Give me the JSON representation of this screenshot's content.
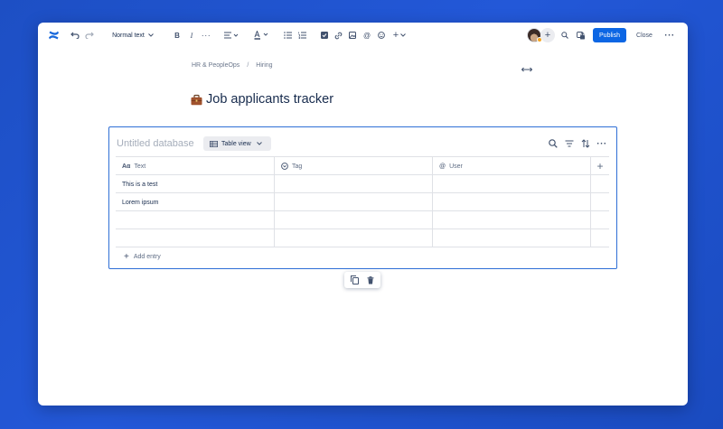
{
  "toolbar": {
    "brand_icon": "confluence-logo-icon",
    "text_style": "Normal text",
    "bold": "B",
    "italic": "I",
    "more_formatting": "···",
    "mention": "@",
    "insert": "+",
    "add_collaborator": "+",
    "publish_label": "Publish",
    "close_label": "Close",
    "more_actions": "···"
  },
  "breadcrumb": {
    "items": [
      "HR & PeopleOps",
      "Hiring"
    ],
    "separator": "/"
  },
  "page": {
    "title": "Job applicants tracker",
    "title_icon": "briefcase-icon"
  },
  "database": {
    "title_placeholder": "Untitled database",
    "view_label": "Table view",
    "more_actions": "···",
    "columns": [
      {
        "label": "Text",
        "icon": "Aα"
      },
      {
        "label": "Tag",
        "icon": "tag-icon"
      },
      {
        "label": "User",
        "icon": "@"
      }
    ],
    "add_column": "+",
    "rows": [
      [
        "This is a test",
        "",
        ""
      ],
      [
        "Lorem ipsum",
        "",
        ""
      ],
      [
        "",
        "",
        ""
      ],
      [
        "",
        "",
        ""
      ]
    ],
    "add_entry_label": "Add entry",
    "add_entry_icon": "+"
  },
  "colors": {
    "primary": "#0c66e4",
    "selection_border": "#2f6fd6",
    "background_gradient": "#1d4fc4"
  }
}
